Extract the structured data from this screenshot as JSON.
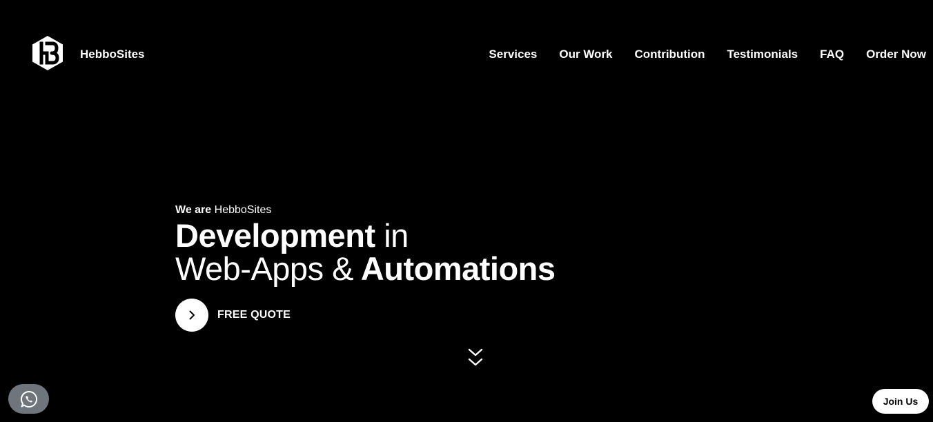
{
  "header": {
    "logo_icon": "hebbosites-hexagon-logo",
    "brand": "HebboSites",
    "nav": [
      {
        "label": "Services"
      },
      {
        "label": "Our Work"
      },
      {
        "label": "Contribution"
      },
      {
        "label": "Testimonials"
      },
      {
        "label": "FAQ"
      },
      {
        "label": "Order Now"
      }
    ]
  },
  "hero": {
    "intro_bold": "We are",
    "intro_rest": "HebboSites",
    "line1_strong": "Development",
    "line1_light": "in",
    "line2_light": "Web-Apps &",
    "line2_strong": "Automations",
    "cta_label": "FREE QUOTE",
    "cta_icon": "chevron-right-icon",
    "scroll_icon": "double-chevron-down-icon"
  },
  "floating": {
    "whatsapp_icon": "whatsapp-icon",
    "join_label": "Join Us"
  },
  "colors": {
    "background": "#000000",
    "text": "#ffffff",
    "whatsapp_bg": "#6f757d"
  }
}
